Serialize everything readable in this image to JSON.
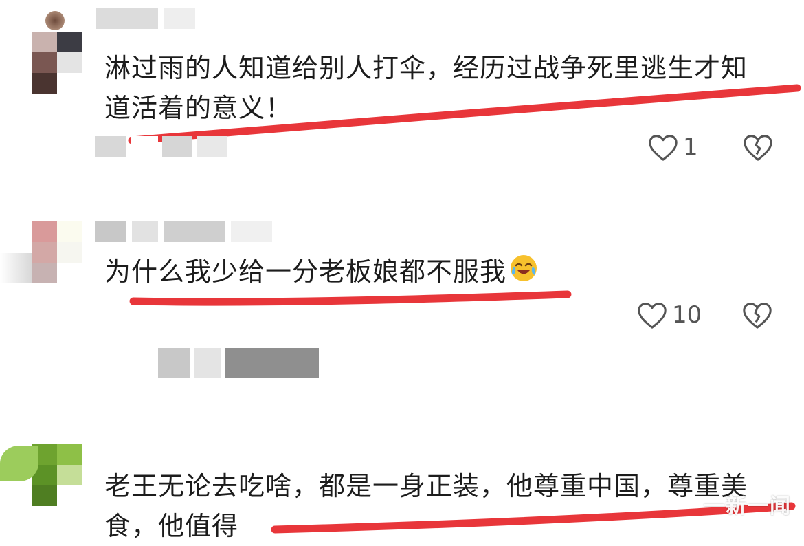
{
  "comments": [
    {
      "text": "淋过雨的人知道给别人打伞，经历过战争死里逃生才知道活着的意义！",
      "like_count": "1"
    },
    {
      "text": "为什么我少给一分老板娘都不服我",
      "emoji_icon": "crying-laughing-emoji",
      "like_count": "10"
    },
    {
      "text": "老王无论去吃啥，都是一身正装，他尊重中国，尊重美食，他值得"
    }
  ],
  "icons": {
    "like": "heart-outline-icon",
    "dislike": "broken-heart-outline-icon"
  },
  "colors": {
    "underline": "#e8363a",
    "icon": "#555555",
    "text": "#1c1c1c"
  },
  "watermark": "一新一闻"
}
